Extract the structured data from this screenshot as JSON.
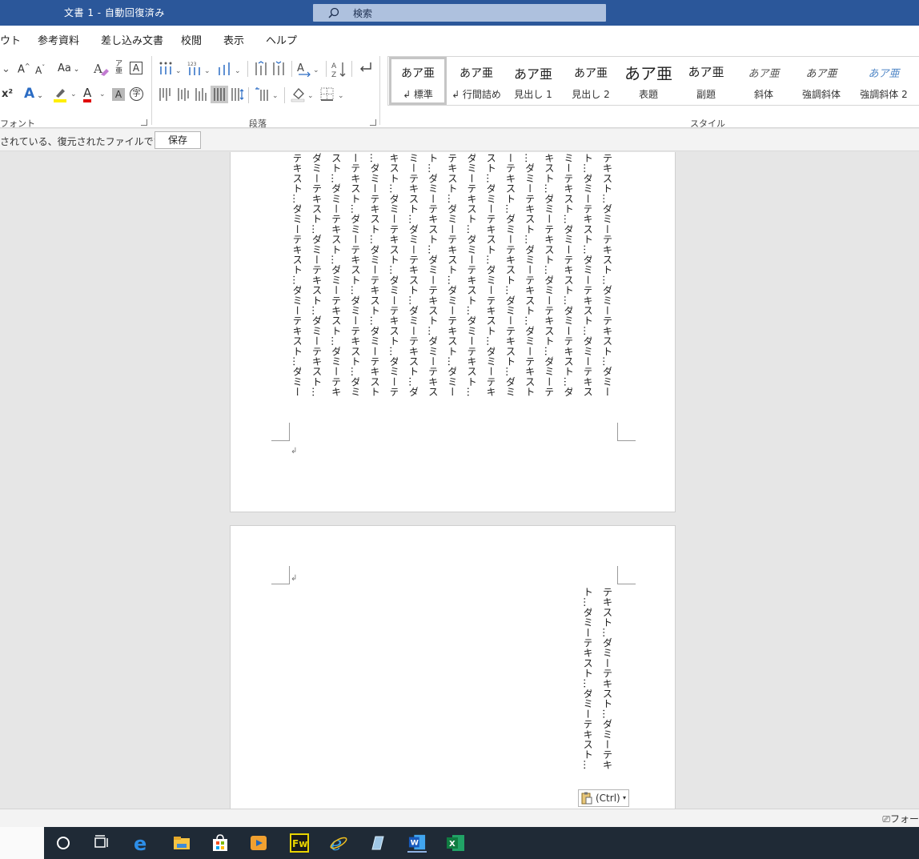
{
  "window": {
    "title": "文書 1  -  自動回復済み",
    "search_placeholder": "検索"
  },
  "menu": {
    "tabs": [
      "ウト",
      "参考資料",
      "差し込み文書",
      "校閲",
      "表示",
      "ヘルプ"
    ]
  },
  "ribbon": {
    "font": {
      "label": "フォント",
      "case_button": "Aa",
      "grow_font": "A",
      "shrink_font": "A",
      "superscript": "x²",
      "char_border": "A"
    },
    "paragraph": {
      "label": "段落"
    },
    "styles": {
      "label": "スタイル",
      "items": [
        {
          "preview": "あア亜",
          "name": "↲ 標準"
        },
        {
          "preview": "あア亜",
          "name": "↲ 行間詰め"
        },
        {
          "preview": "あア亜",
          "name": "見出し 1"
        },
        {
          "preview": "あア亜",
          "name": "見出し 2"
        },
        {
          "preview": "あア亜",
          "name": "表題"
        },
        {
          "preview": "あア亜",
          "name": "副題"
        },
        {
          "preview": "あア亜",
          "name": "斜体"
        },
        {
          "preview": "あア亜",
          "name": "強調斜体"
        },
        {
          "preview": "あア亜",
          "name": "強調斜体 2"
        }
      ]
    }
  },
  "infobar": {
    "message": "されている、復元されたファイルです。",
    "save_label": "保存"
  },
  "document": {
    "page1_columns": [
      "テキスト…ダミーテキスト…ダミーテキスト…ダミー",
      "ト…ダミーテキスト…ダミーテキスト…ダミーテキス",
      "ミーテキスト…ダミーテキスト…ダミーテキスト…ダ",
      "キスト…ダミーテキスト…ダミーテキスト…ダミーテ",
      "…ダミーテキスト…ダミーテキスト…ダミーテキスト",
      "ーテキスト…ダミーテキスト…ダミーテキスト…ダミ",
      "スト…ダミーテキスト…ダミーテキスト…ダミーテキ",
      "ダミーテキスト…ダミーテキスト…ダミーテキスト…",
      "テキスト…ダミーテキスト…ダミーテキスト…ダミー",
      "ト…ダミーテキスト…ダミーテキスト…ダミーテキス",
      "ミーテキスト…ダミーテキスト…ダミーテキスト…ダ",
      "キスト…ダミーテキスト…ダミーテキスト…ダミーテ",
      "…ダミーテキスト…ダミーテキスト…ダミーテキスト",
      "ーテキスト…ダミーテキスト…ダミーテキスト…ダミ",
      "スト…ダミーテキスト…ダミーテキスト…ダミーテキ",
      "ダミーテキスト…ダミーテキスト…ダミーテキスト…",
      "テキスト…ダミーテキスト…ダミーテキスト…ダミー"
    ],
    "page2_columns": [
      "テキスト…ダミーテキスト…ダミーテキ",
      "ト…ダミーテキスト…ダミーテキスト…"
    ],
    "paragraph_mark": "↲",
    "paste_options_label": "(Ctrl)"
  },
  "statusbar": {
    "right_text": "フォー"
  },
  "colors": {
    "word_blue": "#2b579a",
    "search_bg": "#aec1de",
    "taskbar": "#1f2a36"
  }
}
